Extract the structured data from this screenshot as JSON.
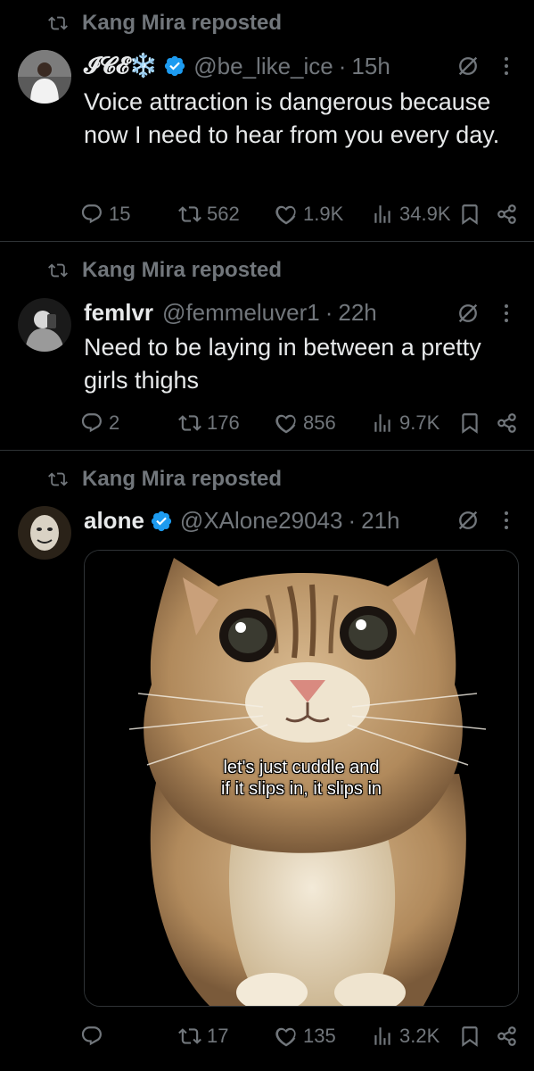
{
  "posts": [
    {
      "repost_label": "Kang Mira reposted",
      "name": "𝓘𝓒𝓔❄️",
      "handle": "@be_like_ice",
      "dot": "·",
      "time": "15h",
      "text": "Voice attraction is dangerous because now I need to hear from you every day.",
      "replies": "15",
      "reposts": "562",
      "likes": "1.9K",
      "views": "34.9K"
    },
    {
      "repost_label": "Kang Mira reposted",
      "name": "femlvr",
      "handle": "@femmeluver1",
      "dot": "·",
      "time": "22h",
      "text": "Need to be laying in between a pretty girls thighs",
      "replies": "2",
      "reposts": "176",
      "likes": "856",
      "views": "9.7K"
    },
    {
      "repost_label": "Kang Mira reposted",
      "name": "alone",
      "handle": "@XAlone29043",
      "dot": "·",
      "time": "21h",
      "image_caption_line1": "let's just cuddle and",
      "image_caption_line2": "if it slips in, it slips in",
      "replies": "",
      "reposts": "17",
      "likes": "135",
      "views": "3.2K"
    }
  ],
  "colors": {
    "background": "#000000",
    "text": "#e7e9ea",
    "secondary": "#71767b",
    "verified": "#1d9bf0",
    "divider": "#2f3336"
  },
  "icons": [
    "repost-icon",
    "verified-badge-icon",
    "grok-icon",
    "more-icon",
    "reply-icon",
    "retweet-icon",
    "like-icon",
    "views-icon",
    "bookmark-icon",
    "share-icon"
  ]
}
